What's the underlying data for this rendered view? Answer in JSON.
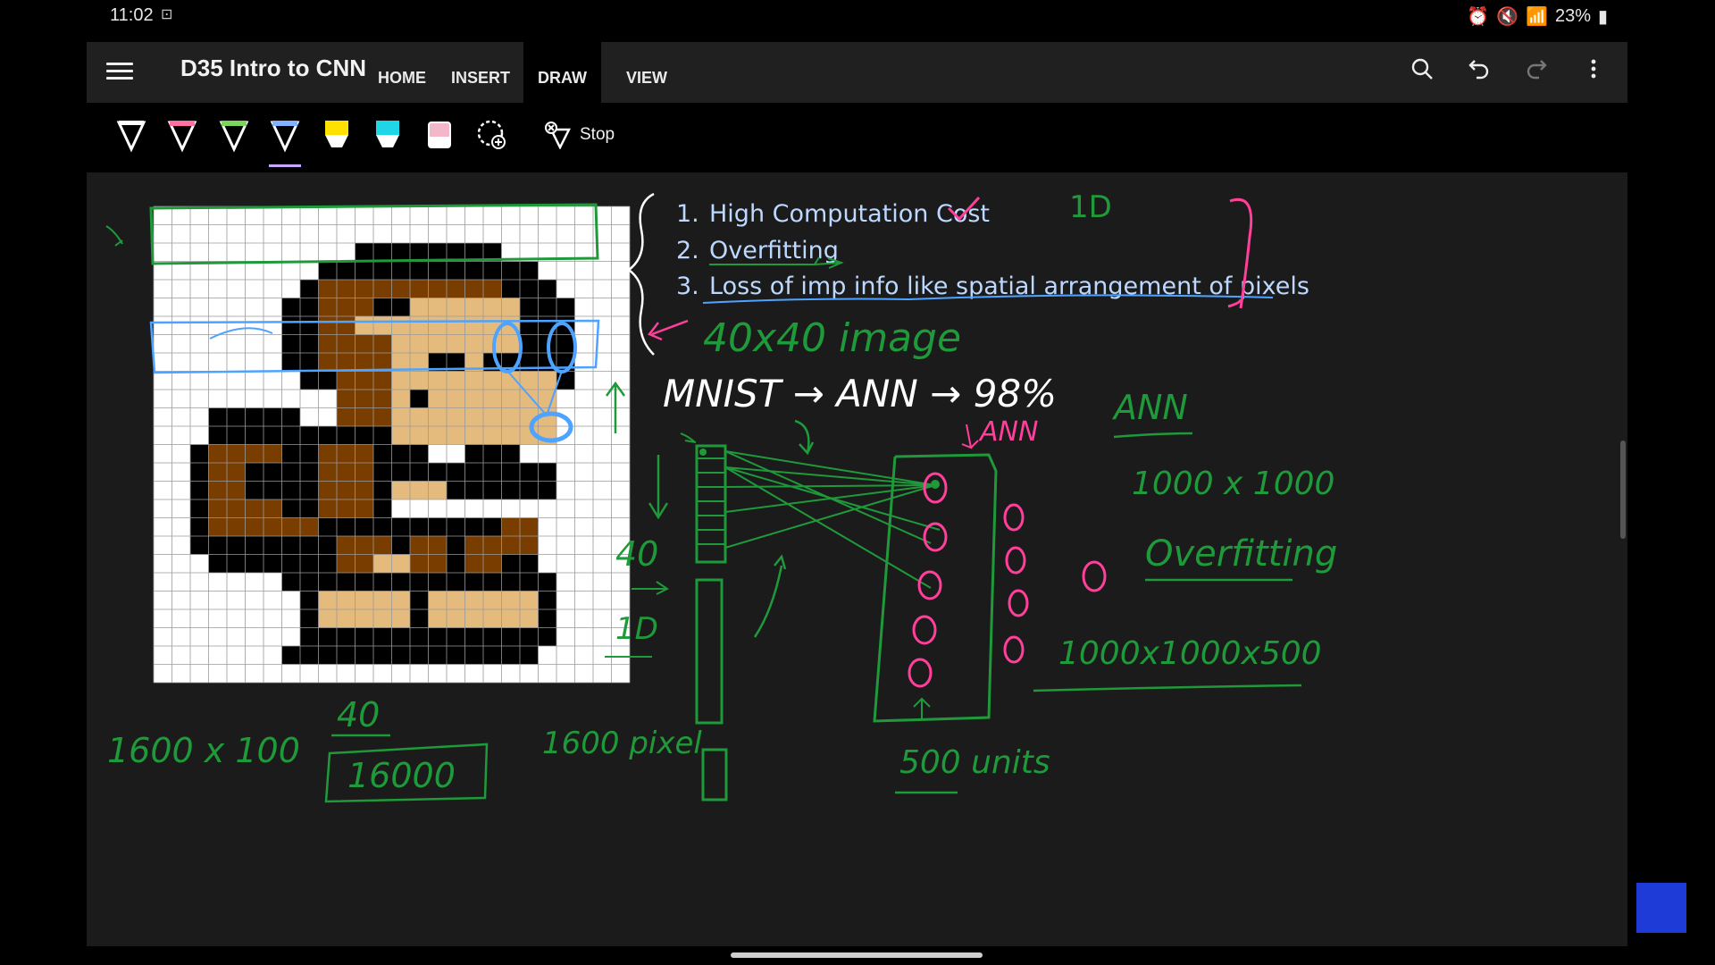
{
  "status": {
    "time": "11:02",
    "battery": "23%"
  },
  "app": {
    "title": "D35 Intro to CNN",
    "tabs": [
      {
        "label": "HOME"
      },
      {
        "label": "INSERT"
      },
      {
        "label": "DRAW"
      },
      {
        "label": "VIEW"
      }
    ],
    "active_tab": "DRAW"
  },
  "toolbar": {
    "stop_label": "Stop",
    "pen_colors": [
      "#ffffff",
      "#ff6fa5",
      "#7ad65b",
      "#7fb2ff",
      "#ffe100",
      "#1ed6e6",
      "#f2b8c9"
    ]
  },
  "notes": {
    "list": [
      {
        "num": "1.",
        "text": "High Computation Cost"
      },
      {
        "num": "2.",
        "text": "Overfitting"
      },
      {
        "num": "3.",
        "text": "Loss of imp info like spatial arrangement of pixels"
      }
    ],
    "h_1d_top": "1D",
    "img_size": "40x40 image",
    "mnist": "MNIST → ANN → 98%",
    "ann_small": "ANN",
    "ann_right": "ANN",
    "dim_right": "1000 x 1000",
    "overfitting": "Overfitting",
    "product": "1000x1000x500",
    "n40": "40",
    "n1d": "1D",
    "left_bottom": "1600 x 100",
    "mid_40": "40",
    "mid_box": "16000",
    "pixels": "1600 pixel",
    "units": "500 units"
  },
  "colors": {
    "green_ink": "#1f9a3a",
    "pink_ink": "#ff3f9a",
    "blue_ink": "#5aa8ff",
    "text_blue": "#bcd8ff"
  }
}
